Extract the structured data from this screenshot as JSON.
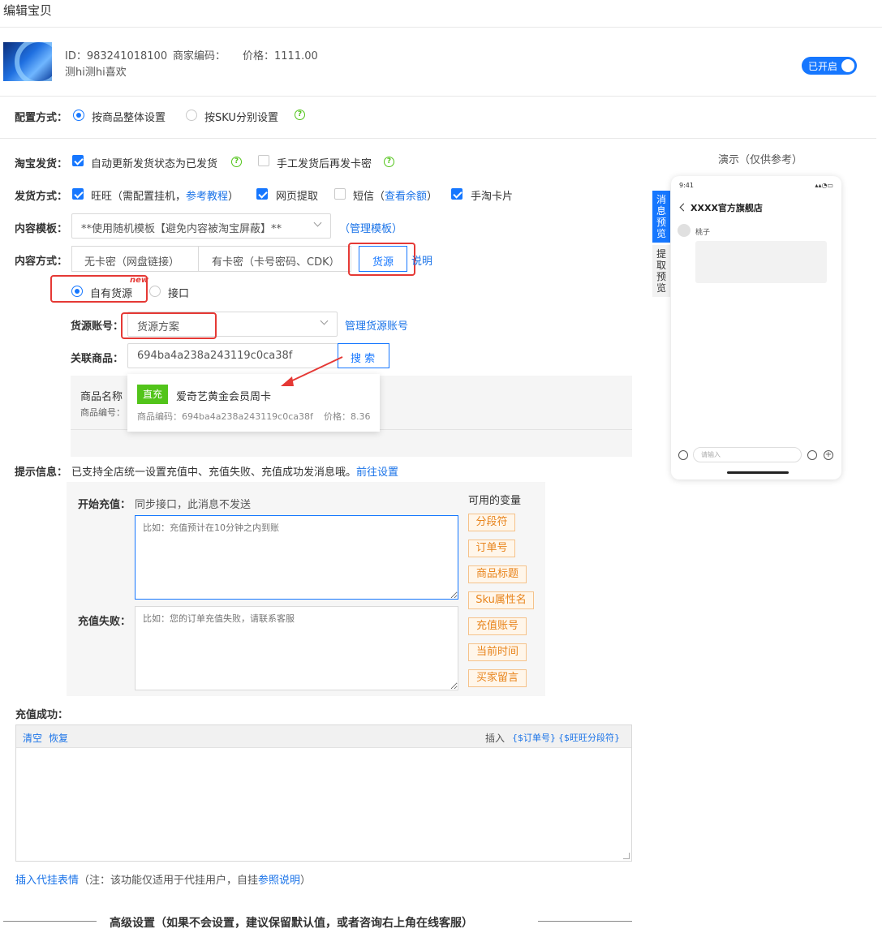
{
  "page": {
    "title": "编辑宝贝"
  },
  "product": {
    "id_text": "ID：983241018100",
    "merchant_code_text": "商家编码：",
    "price_text": "价格：1111.00",
    "name": "测hi测hi喜欢",
    "toggle_label": "已开启"
  },
  "config": {
    "label": "配置方式：",
    "option_whole": "按商品整体设置",
    "option_sku": "按SKU分别设置"
  },
  "taobao_ship": {
    "label": "淘宝发货：",
    "auto_update": "自动更新发货状态为已发货",
    "manual": "手工发货后再发卡密"
  },
  "ship_method": {
    "label": "发货方式：",
    "wangwang": "旺旺（需配置挂机，",
    "ref_tutorial": "参考教程",
    "close_paren": "）",
    "web_pickup": "网页提取",
    "sms": "短信（",
    "view_balance": "查看余额",
    "sms_close": "）",
    "handtao": "手淘卡片"
  },
  "content_template": {
    "label": "内容模板：",
    "selected": "**使用随机模板【避免内容被淘宝屏蔽】**",
    "manage_open": "（",
    "manage": "管理模板",
    "manage_close": "）"
  },
  "content_mode": {
    "label": "内容方式：",
    "tabs": [
      "无卡密（网盘链接）",
      "有卡密（卡号密码、CDK）",
      "货源"
    ],
    "explain": "说明"
  },
  "source_type": {
    "own": "自有货源",
    "new_badge": "new",
    "api": "接口"
  },
  "source_account": {
    "label": "货源账号：",
    "selected": "货源方案",
    "manage": "管理货源账号"
  },
  "linked_product": {
    "label": "关联商品：",
    "value": "694ba4a238a243119c0ca38f",
    "search": "搜 索",
    "table_name": "商品名称",
    "table_code": "商品编号："
  },
  "search_result": {
    "badge": "直充",
    "title": "爱奇艺黄金会员周卡",
    "code": "商品编码：694ba4a238a243119c0ca38f",
    "price": "价格：8.36"
  },
  "tip": {
    "label": "提示信息：",
    "text": "已支持全店统一设置充值中、充值失败、充值成功发消息哦。",
    "link": "前往设置"
  },
  "recharge": {
    "start_label": "开始充值：",
    "start_note": "同步接口，此消息不发送",
    "start_placeholder": "比如：充值预计在10分钟之内到账",
    "fail_label": "充值失败：",
    "fail_placeholder": "比如：您的订单充值失败，请联系客服",
    "vars_title": "可用的变量",
    "vars": [
      "分段符",
      "订单号",
      "商品标题",
      "Sku属性名",
      "充值账号",
      "当前时间",
      "买家留言"
    ],
    "success_label": "充值成功："
  },
  "editor": {
    "clear": "清空",
    "restore": "恢复",
    "insert": "插入",
    "insert_order": "{$订单号}",
    "insert_seg": "{$旺旺分段符}"
  },
  "footer_note": {
    "insert_emoji": "插入代挂表情",
    "note": "（注：该功能仅适用于代挂用户，自挂",
    "ref": "参照说明",
    "close": "）"
  },
  "advanced": {
    "title": "高级设置（如果不会设置，建议保留默认值，或者咨询右上角在线客服）"
  },
  "preview": {
    "title": "演示（仅供参考）",
    "tab_message": "消息预览",
    "tab_extract": "提取预览",
    "time": "9:41",
    "shop": "XXXX官方旗舰店",
    "user": "桃子",
    "input_placeholder": "请输入"
  },
  "colors": {
    "accent": "#1677ff",
    "annotation": "#e53935",
    "tag": "#e8841c",
    "badge_green": "#52c41a"
  }
}
